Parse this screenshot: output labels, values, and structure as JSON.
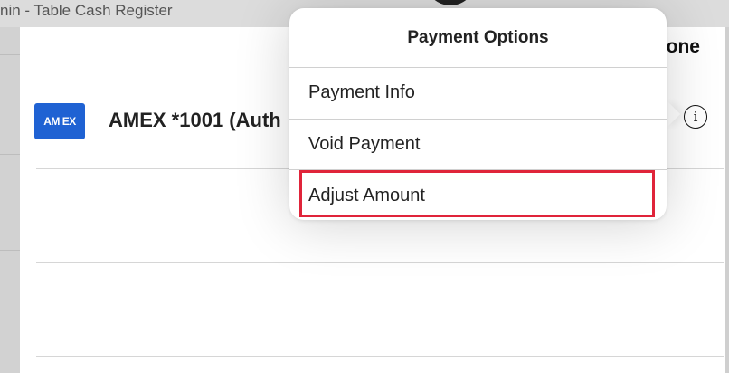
{
  "background": {
    "title": "nin - Table Cash Register"
  },
  "sheet": {
    "done_label": "one",
    "payment": {
      "card_brand": "AM EX",
      "label": "AMEX *1001 (Auth"
    }
  },
  "popover": {
    "title": "Payment Options",
    "items": [
      {
        "label": "Payment Info"
      },
      {
        "label": "Void Payment"
      },
      {
        "label": "Adjust Amount"
      }
    ]
  },
  "colors": {
    "amex_blue": "#1f62d3",
    "highlight_red": "#e0243a"
  },
  "icons": {
    "info": "info-icon"
  }
}
